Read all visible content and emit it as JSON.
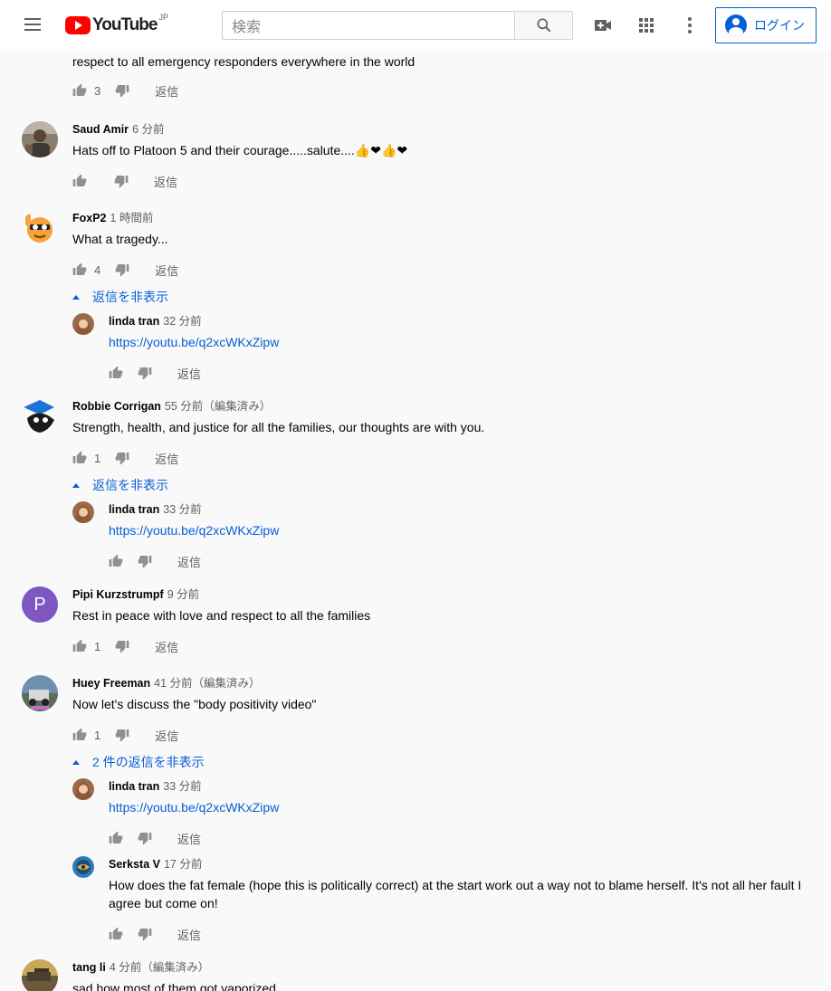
{
  "masthead": {
    "logo_text": "YouTube",
    "logo_region": "JP",
    "search_placeholder": "検索",
    "signin_label": "ログイン"
  },
  "comments": {
    "reply_label": "返信",
    "partial_top": {
      "text": "respect to all emergency responders everywhere in the world",
      "likes": "3"
    },
    "threads": [
      {
        "author": "Saud Amir",
        "time": "6 分前",
        "text": "Hats off to Platoon 5 and their courage.....salute....👍❤👍❤",
        "likes": ""
      },
      {
        "author": "FoxP2",
        "time": "1 時間前",
        "text": "What a tragedy...",
        "likes": "4",
        "toggle": "返信を非表示",
        "replies": [
          {
            "author": "linda tran",
            "time": "32 分前",
            "text": "https://youtu.be/q2xcWKxZipw"
          }
        ]
      },
      {
        "author": "Robbie Corrigan",
        "time": "55 分前（編集済み）",
        "text": "Strength, health, and justice for all the families, our thoughts are with you.",
        "likes": "1",
        "toggle": "返信を非表示",
        "replies": [
          {
            "author": "linda tran",
            "time": "33 分前",
            "text": "https://youtu.be/q2xcWKxZipw"
          }
        ]
      },
      {
        "author": "Pipi Kurzstrumpf",
        "time": "9 分前",
        "text": "Rest in peace with love and respect to all the families",
        "likes": "1",
        "avatar_letter": "P",
        "avatar_color": "#7e57c2"
      },
      {
        "author": "Huey Freeman",
        "time": "41 分前（編集済み）",
        "text": "Now let's discuss the \"body positivity video\"",
        "likes": "1",
        "toggle": "2 件の返信を非表示",
        "replies": [
          {
            "author": "linda tran",
            "time": "33 分前",
            "text": "https://youtu.be/q2xcWKxZipw"
          },
          {
            "author": "Serksta V",
            "time": "17 分前",
            "text": "How does the fat female (hope this is politically correct) at the start work out a way not to blame herself. It's not all her fault I agree but come on!"
          }
        ]
      },
      {
        "author": "tang li",
        "time": "4 分前（編集済み）",
        "text": "sad how most of them got vaporized"
      }
    ]
  },
  "colors": {
    "accent": "#065fd4",
    "brand": "#ff0000",
    "text_secondary": "#606060"
  }
}
